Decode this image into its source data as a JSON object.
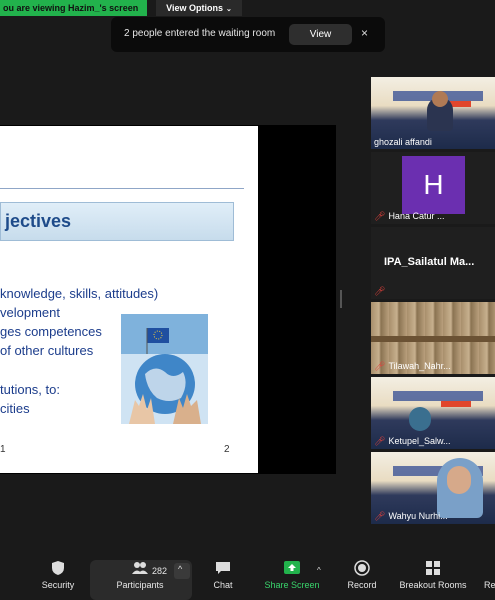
{
  "share_banner": {
    "text": "ou are viewing Hazim_'s screen"
  },
  "view_options": {
    "label": "View Options"
  },
  "toast": {
    "text": "2 people entered the waiting room",
    "view_label": "View",
    "close": "×"
  },
  "slide": {
    "title": "jectives",
    "lines": [
      "knowledge, skills, attitudes)",
      "velopment",
      "ges competences",
      "of other cultures",
      "tutions, to:",
      "cities"
    ],
    "page_number": "2",
    "page_left": "1"
  },
  "gallery": {
    "tiles": [
      {
        "name": "ghozali affandi",
        "muted": false
      },
      {
        "name": "Hana Catur ...",
        "muted": true,
        "initial": "H"
      },
      {
        "name": "IPA_Sailatul  Ma...",
        "muted": true
      },
      {
        "name": "Tilawah_Nahr...",
        "muted": true
      },
      {
        "name": "Ketupel_Salw...",
        "muted": true
      },
      {
        "name": "Wahyu Nurhi...",
        "muted": true
      }
    ]
  },
  "toolbar": {
    "security": "Security",
    "participants": "Participants",
    "participant_count": "282",
    "chat": "Chat",
    "share_screen": "Share Screen",
    "record": "Record",
    "breakout_rooms": "Breakout Rooms",
    "reactions": "Re"
  },
  "colors": {
    "share_green": "#22b24c",
    "slide_title_blue": "#1e4b8a",
    "slide_text_blue": "#1c3d8c",
    "muted_red": "#e0403b",
    "avatar_purple": "#6b2fb0"
  }
}
